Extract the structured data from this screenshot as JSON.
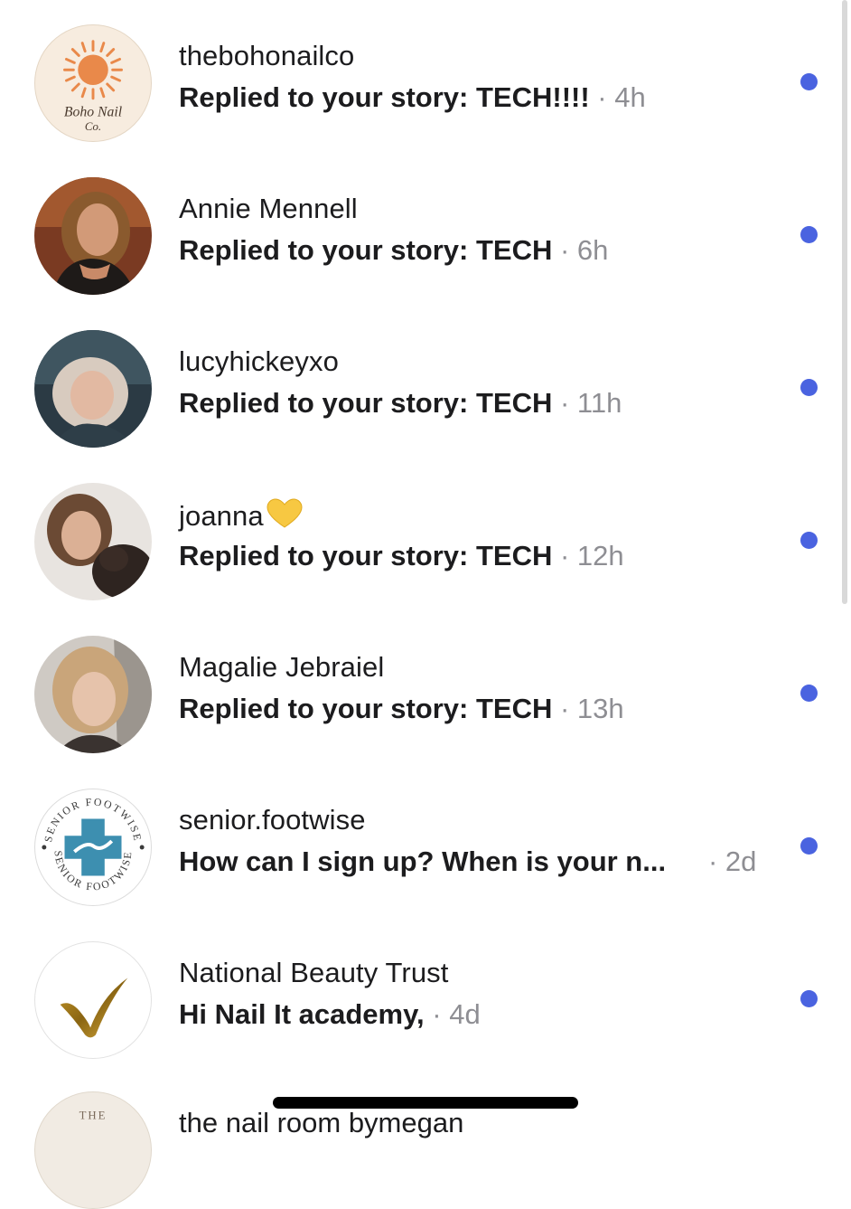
{
  "threads": [
    {
      "name": "thebohonailco",
      "message": "Replied to your story: TECH!!!!",
      "time": "· 4h",
      "avatar": "boho-nail-co-logo",
      "logo_text_line1": "Boho Nail",
      "logo_text_line2": "Co.",
      "unread": true
    },
    {
      "name": "Annie Mennell",
      "message": "Replied to your story: TECH",
      "time": "· 6h",
      "avatar": "profile-photo",
      "unread": true
    },
    {
      "name": "lucyhickeyxo",
      "message": "Replied to your story: TECH",
      "time": "· 11h",
      "avatar": "profile-photo",
      "unread": true
    },
    {
      "name": "joanna",
      "message": "Replied to your story: TECH",
      "time": "· 12h",
      "avatar": "profile-photo",
      "name_emoji": "yellow-heart-icon",
      "unread": true
    },
    {
      "name": "Magalie Jebraiel",
      "message": "Replied to your story: TECH",
      "time": "· 13h",
      "avatar": "profile-photo",
      "unread": true
    },
    {
      "name": "senior.footwise",
      "message": "How can I sign up? When is your n...",
      "time": "· 2d",
      "avatar": "senior-footwise-logo",
      "logo_text": "SENIOR FOOTWISE",
      "unread": true
    },
    {
      "name": "National Beauty Trust",
      "message": "Hi Nail It academy,",
      "time": "· 4d",
      "avatar": "gold-checkmark-logo",
      "unread": true
    },
    {
      "name": "the nail room bymegan",
      "avatar_text": "THE"
    }
  ],
  "colors": {
    "unread_dot": "#4a63e0",
    "timestamp": "#8e8e93",
    "text": "#1c1c1e"
  }
}
